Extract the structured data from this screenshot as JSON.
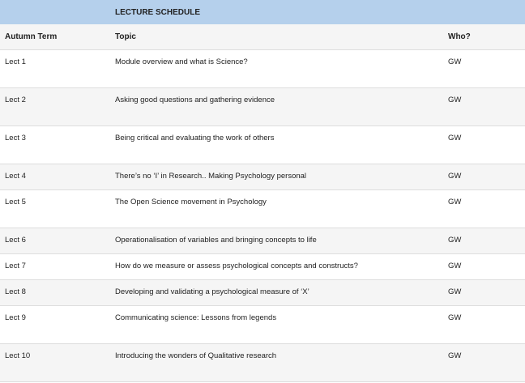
{
  "schedule": {
    "title": "LECTURE SCHEDULE",
    "columns": {
      "term": "Autumn Term",
      "topic": "Topic",
      "who": "Who?"
    },
    "rows": [
      {
        "lecture": "Lect 1",
        "topic": "Module overview and what is Science?",
        "who": "GW"
      },
      {
        "lecture": "Lect 2",
        "topic": "Asking good questions and gathering evidence",
        "who": "GW"
      },
      {
        "lecture": "Lect 3",
        "topic": "Being critical and evaluating the work of others",
        "who": "GW"
      },
      {
        "lecture": "Lect 4",
        "topic": "There’s no ‘I’ in Research.. Making Psychology personal",
        "who": "GW"
      },
      {
        "lecture": "Lect 5",
        "topic": "The Open Science movement in Psychology",
        "who": "GW"
      },
      {
        "lecture": "Lect 6",
        "topic": "Operationalisation of variables and bringing concepts to life",
        "who": "GW"
      },
      {
        "lecture": "Lect 7",
        "topic": "How do we measure or assess psychological concepts and constructs?",
        "who": "GW"
      },
      {
        "lecture": "Lect 8",
        "topic": "Developing and validating a psychological measure of ‘X’",
        "who": "GW"
      },
      {
        "lecture": "Lect 9",
        "topic": "Communicating science: Lessons from legends",
        "who": "GW"
      },
      {
        "lecture": "Lect 10",
        "topic": "Introducing the wonders of Qualitative research",
        "who": "GW"
      }
    ]
  }
}
